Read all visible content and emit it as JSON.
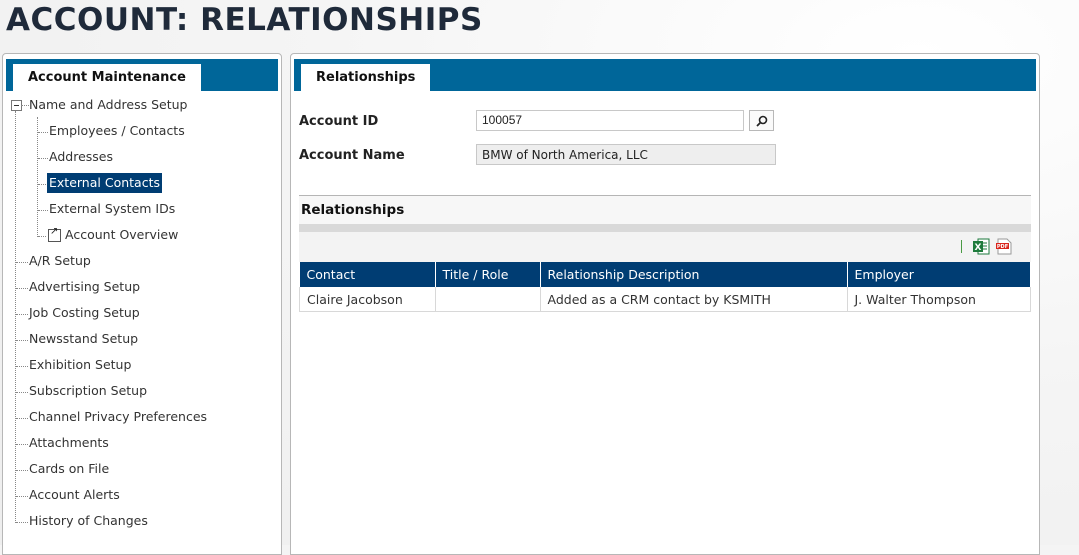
{
  "page": {
    "title": "ACCOUNT: RELATIONSHIPS"
  },
  "sidebar": {
    "tab": "Account Maintenance",
    "items": [
      {
        "label": "Name and Address Setup"
      },
      {
        "label": "Employees / Contacts"
      },
      {
        "label": "Addresses"
      },
      {
        "label": "External Contacts",
        "selected": true
      },
      {
        "label": "External System IDs"
      },
      {
        "label": "Account Overview"
      },
      {
        "label": "A/R Setup"
      },
      {
        "label": "Advertising Setup"
      },
      {
        "label": "Job Costing Setup"
      },
      {
        "label": "Newsstand Setup"
      },
      {
        "label": "Exhibition Setup"
      },
      {
        "label": "Subscription Setup"
      },
      {
        "label": "Channel Privacy Preferences"
      },
      {
        "label": "Attachments"
      },
      {
        "label": "Cards on File"
      },
      {
        "label": "Account Alerts"
      },
      {
        "label": "History of Changes"
      }
    ]
  },
  "main": {
    "tab": "Relationships",
    "account_id_label": "Account ID",
    "account_id_value": "100057",
    "account_name_label": "Account Name",
    "account_name_value": "BMW of North America, LLC",
    "section_title": "Relationships",
    "table": {
      "columns": [
        "Contact",
        "Title / Role",
        "Relationship Description",
        "Employer"
      ],
      "rows": [
        [
          "Claire Jacobson",
          "",
          "Added as a CRM contact by KSMITH",
          "J. Walter Thompson"
        ]
      ]
    }
  },
  "colors": {
    "header_blue": "#006699",
    "table_header": "#003d73",
    "link": "#1a76a6",
    "selected": "#003d73"
  },
  "icons": [
    "search-icon",
    "excel-export-icon",
    "pdf-export-icon",
    "external-link-icon",
    "collapse-icon"
  ]
}
